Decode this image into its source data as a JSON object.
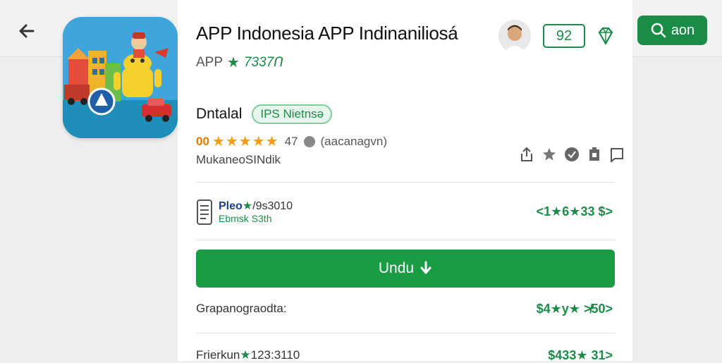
{
  "topbar": {
    "search_label": "aon"
  },
  "app": {
    "title": "APP Indonesia APP Indinaniliosá",
    "publisher": "APP",
    "publisher_rating": "7337Ո",
    "count_badge": "92"
  },
  "details": {
    "heading": "Dntalal",
    "chip": "IPS Nietnsə",
    "rating_value": "00",
    "rating_count": "47",
    "reviews_label": "(aacanagvn)",
    "developer": "MukaneoSINdik"
  },
  "info": {
    "line1_bold": "Pleo",
    "line1_rest": "/9s3010",
    "line2": "Ebmsk  S3th",
    "right_value": "<1★6★33 $>"
  },
  "install": {
    "label": "Undu"
  },
  "rows": [
    {
      "label": "Grapanograodta:",
      "value": "$4★y★ ≯50>"
    },
    {
      "label": "Frierkun",
      "label_extra": "123:3110",
      "value": "$433★ 31>"
    }
  ],
  "colors": {
    "accent": "#1a8c48",
    "install": "#1a9c45",
    "rating_orange": "#f39c12"
  },
  "icons": [
    "back-arrow-icon",
    "search-icon",
    "user-avatar-icon",
    "diamond-icon",
    "star-icon",
    "verified-icon",
    "share-icon",
    "bookmark-icon",
    "flag-icon",
    "document-icon",
    "download-arrow-icon"
  ]
}
